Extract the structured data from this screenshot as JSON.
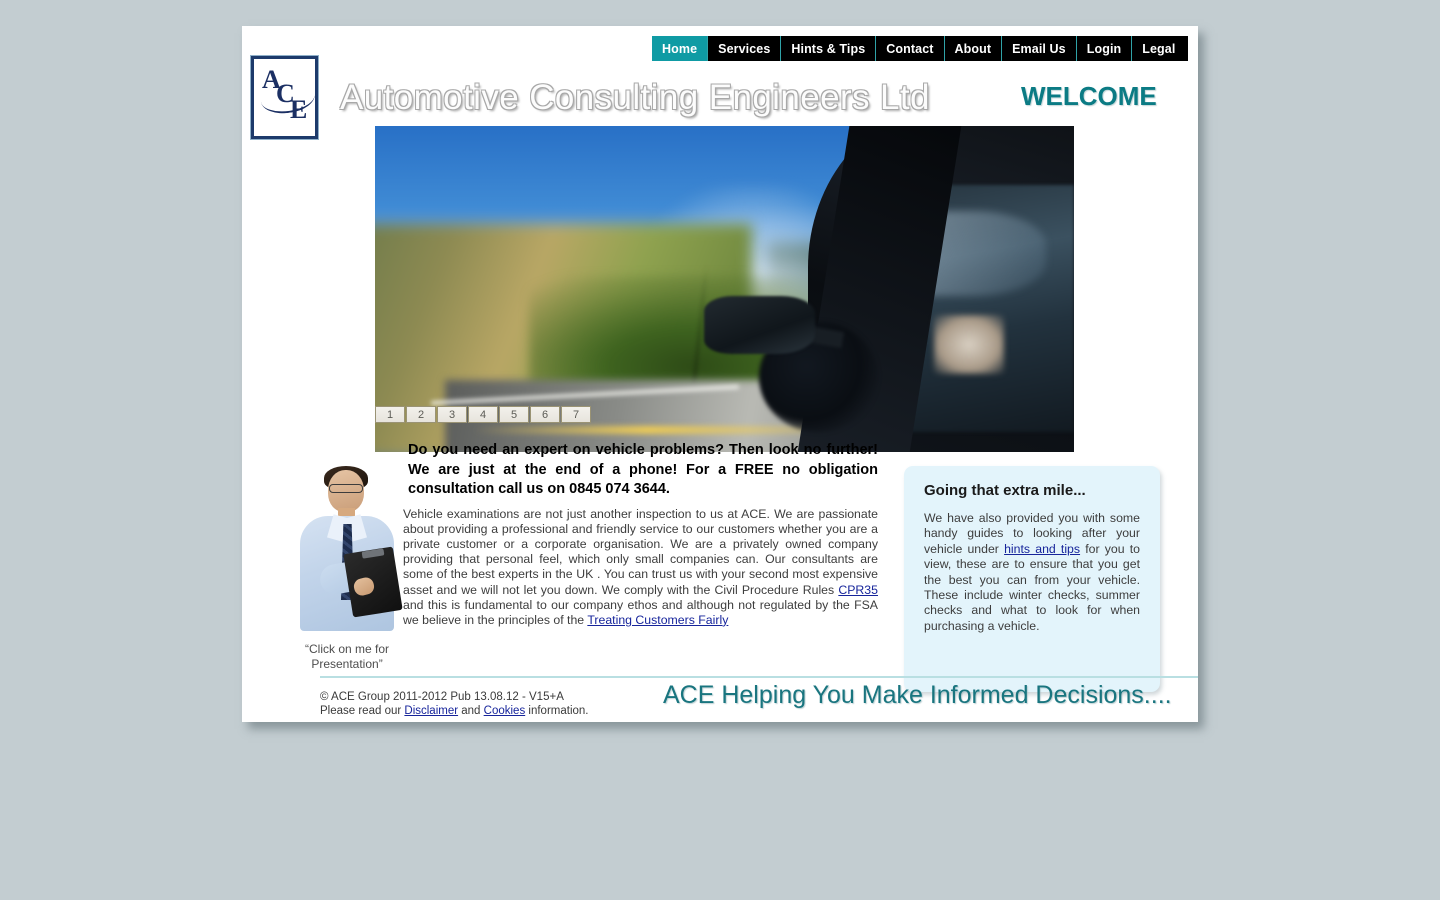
{
  "nav": {
    "items": [
      {
        "label": "Home",
        "active": true
      },
      {
        "label": "Services",
        "active": false
      },
      {
        "label": "Hints & Tips",
        "active": false
      },
      {
        "label": "Contact",
        "active": false
      },
      {
        "label": "About",
        "active": false
      },
      {
        "label": "Email Us",
        "active": false
      },
      {
        "label": "Login",
        "active": false
      },
      {
        "label": "Legal",
        "active": false
      }
    ]
  },
  "header": {
    "logo_letters": {
      "a": "A",
      "c": "C",
      "e": "E"
    },
    "site_title": "Automotive Consulting Engineers Ltd",
    "welcome": "WELCOME",
    "accent_teal": "#0b7b84",
    "nav_active_color": "#0f9ba4"
  },
  "hero": {
    "alt": "Motion-blurred view from a moving car on a country road",
    "slides": [
      "1",
      "2",
      "3",
      "4",
      "5",
      "6",
      "7"
    ],
    "active_slide": "1"
  },
  "main": {
    "lead": "Do you need an expert on vehicle problems? Then look no further! We are just at the end of a phone! For a FREE no obligation consultation call us on 0845 074 3644.",
    "body_part1": "Vehicle examinations are not just another inspection to us at ACE. We are passionate about providing a professional and friendly service to our customers whether you are a private customer or a corporate organisation.  We are a privately owned company providing that personal feel, which only small companies can. Our consultants are some of the best experts in the UK .  You can trust us with your second most expensive asset and we will not let you down. We comply with the Civil Procedure Rules ",
    "link_cpr35": "CPR35",
    "body_part2": " and this is fundamental to our company ethos and although not regulated by the FSA we believe in the principles of the ",
    "link_tcf": "Treating Customers Fairly",
    "consultant_caption": "“Click on me for Presentation”"
  },
  "side_panel": {
    "title": "Going that extra mile...",
    "text_part1": "We have also provided you with some handy guides to looking after your vehicle under ",
    "link_hints": "hints and tips",
    "text_part2": " for you to view, these are to ensure that you get the best you can from your vehicle.  These include winter checks, summer checks and what to look for when purchasing a vehicle.",
    "background": "#e3f4fb"
  },
  "footer": {
    "copyright": "© ACE Group 2011-2012 Pub 13.08.12 - V15+A",
    "read_prefix": "Please read our ",
    "link_disclaimer": "Disclaimer",
    "read_middle": " and ",
    "link_cookies": "Cookies",
    "read_suffix": " information.",
    "tagline": "ACE Helping You Make Informed Decisions...."
  }
}
